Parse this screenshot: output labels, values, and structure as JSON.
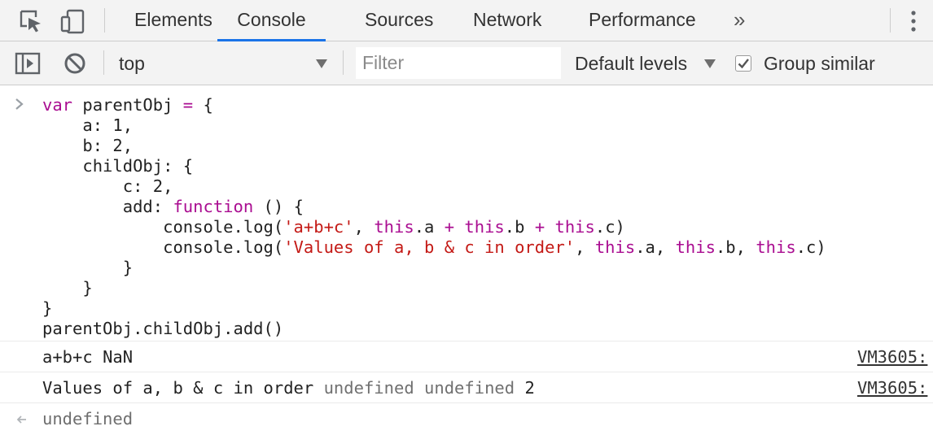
{
  "tabs": {
    "elements": "Elements",
    "console": "Console",
    "sources": "Sources",
    "network": "Network",
    "performance": "Performance",
    "more": "»"
  },
  "toolbar": {
    "context": "top",
    "filter_placeholder": "Filter",
    "levels": "Default levels",
    "group_similar": "Group similar",
    "group_similar_checked": true
  },
  "console": {
    "input_code": [
      [
        {
          "t": "var",
          "c": "kw"
        },
        {
          "t": " parentObj ",
          "c": "plain"
        },
        {
          "t": "=",
          "c": "op"
        },
        {
          "t": " {",
          "c": "plain"
        }
      ],
      [
        {
          "t": "    a: 1,",
          "c": "plain"
        }
      ],
      [
        {
          "t": "    b: 2,",
          "c": "plain"
        }
      ],
      [
        {
          "t": "    childObj: {",
          "c": "plain"
        }
      ],
      [
        {
          "t": "        c: 2,",
          "c": "plain"
        }
      ],
      [
        {
          "t": "        add: ",
          "c": "plain"
        },
        {
          "t": "function",
          "c": "kw"
        },
        {
          "t": " () {",
          "c": "plain"
        }
      ],
      [
        {
          "t": "            console.log(",
          "c": "plain"
        },
        {
          "t": "'a+b+c'",
          "c": "str"
        },
        {
          "t": ", ",
          "c": "plain"
        },
        {
          "t": "this",
          "c": "kw"
        },
        {
          "t": ".a ",
          "c": "plain"
        },
        {
          "t": "+",
          "c": "op"
        },
        {
          "t": " ",
          "c": "plain"
        },
        {
          "t": "this",
          "c": "kw"
        },
        {
          "t": ".b ",
          "c": "plain"
        },
        {
          "t": "+",
          "c": "op"
        },
        {
          "t": " ",
          "c": "plain"
        },
        {
          "t": "this",
          "c": "kw"
        },
        {
          "t": ".c)",
          "c": "plain"
        }
      ],
      [
        {
          "t": "            console.log(",
          "c": "plain"
        },
        {
          "t": "'Values of a, b & c in order'",
          "c": "str"
        },
        {
          "t": ", ",
          "c": "plain"
        },
        {
          "t": "this",
          "c": "kw"
        },
        {
          "t": ".a, ",
          "c": "plain"
        },
        {
          "t": "this",
          "c": "kw"
        },
        {
          "t": ".b, ",
          "c": "plain"
        },
        {
          "t": "this",
          "c": "kw"
        },
        {
          "t": ".c)",
          "c": "plain"
        }
      ],
      [
        {
          "t": "        }",
          "c": "plain"
        }
      ],
      [
        {
          "t": "    }",
          "c": "plain"
        }
      ],
      [
        {
          "t": "}",
          "c": "plain"
        }
      ],
      [
        {
          "t": "parentObj.childObj.add()",
          "c": "plain"
        }
      ]
    ],
    "log1": {
      "label": "a+b+c",
      "value": "NaN",
      "source": "VM3605:"
    },
    "log2": {
      "label": "Values of a, b & c in order",
      "v1": "undefined",
      "v2": "undefined",
      "v3": "2",
      "source": "VM3605:"
    },
    "result": "undefined",
    "prompt_glyph": "❯",
    "result_glyph": "←"
  },
  "colors": {
    "keyword": "#aa0d91",
    "string": "#c41a16",
    "accent": "#1a73e8"
  },
  "icons": [
    "inspect-icon",
    "device-toolbar-icon",
    "kebab-menu-icon",
    "sidebar-toggle-icon",
    "clear-console-icon",
    "checkmark-icon"
  ]
}
